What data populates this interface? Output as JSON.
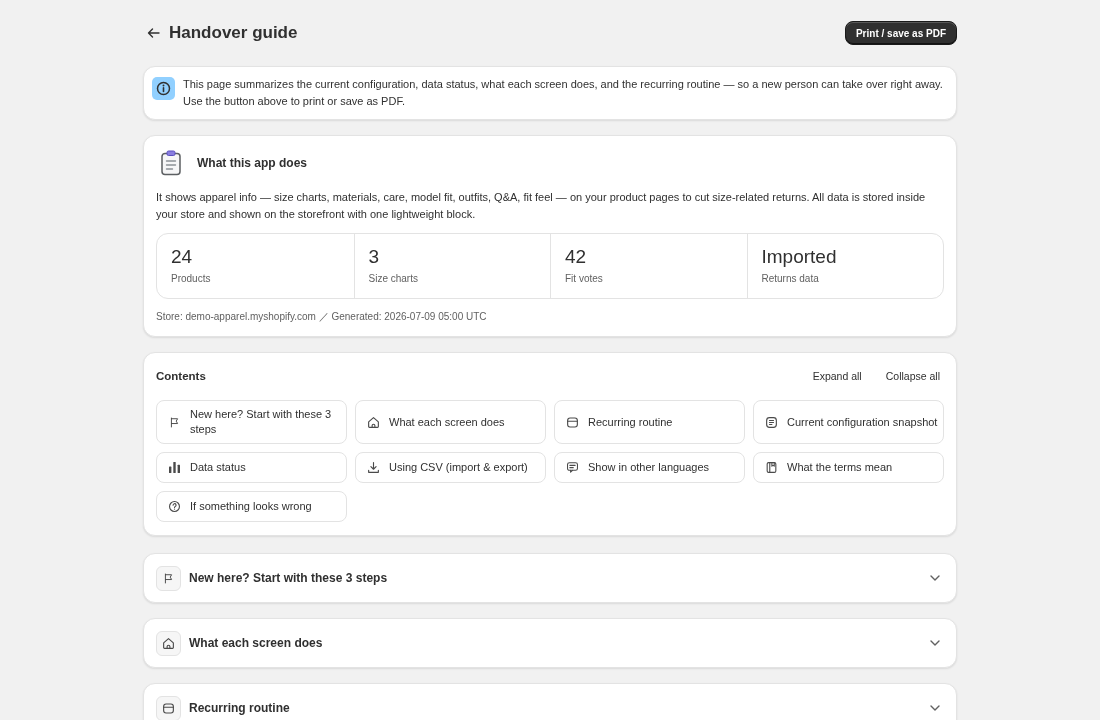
{
  "header": {
    "title": "Handover guide",
    "print_button": "Print / save as PDF"
  },
  "info_banner": {
    "text": "This page summarizes the current configuration, data status, what each screen does, and the recurring routine — so a new person can take over right away.\nUse the button above to print or save as PDF."
  },
  "about": {
    "title": "What this app does",
    "description": "It shows apparel info — size charts, materials, care, model fit, outfits, Q&A, fit feel — on your product pages to cut size-related returns. All data is stored inside your store and shown on the storefront with one lightweight block.",
    "stats": [
      {
        "value": "24",
        "label": "Products"
      },
      {
        "value": "3",
        "label": "Size charts"
      },
      {
        "value": "42",
        "label": "Fit votes"
      },
      {
        "value": "Imported",
        "label": "Returns data"
      }
    ],
    "footer": "Store: demo-apparel.myshopify.com ／ Generated: 2026-07-09 05:00 UTC"
  },
  "contents": {
    "title": "Contents",
    "actions": [
      "Expand all",
      "Collapse all"
    ],
    "items": [
      "New here? Start with these 3 steps",
      "What each screen does",
      "Recurring routine",
      "Current configuration snapshot",
      "Data status",
      "Using CSV (import & export)",
      "Show in other languages",
      "What the terms mean",
      "If something looks wrong"
    ]
  },
  "sections": [
    {
      "title": "New here? Start with these 3 steps",
      "expanded": false
    },
    {
      "title": "What each screen does",
      "expanded": false
    },
    {
      "title": "Recurring routine",
      "expanded": false
    }
  ]
}
